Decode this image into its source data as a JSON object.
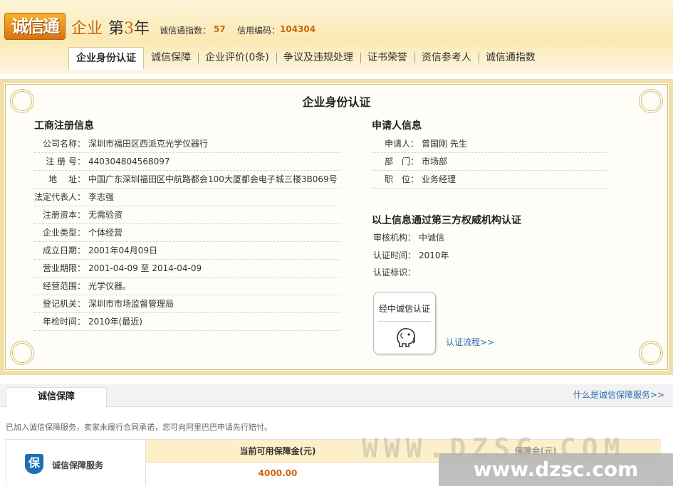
{
  "header": {
    "logo": "诚信通",
    "corp": "企业",
    "year_prefix": "第",
    "year_num": "3",
    "year_suffix": "年",
    "index_label": "诚信通指数：",
    "index_value": "57",
    "code_label": "信用编码：",
    "code_value": "104304"
  },
  "tabs": [
    {
      "label": "企业身份认证",
      "active": true
    },
    {
      "label": "诚信保障"
    },
    {
      "label": "企业评价(0条)"
    },
    {
      "label": "争议及违规处理"
    },
    {
      "label": "证书荣誉"
    },
    {
      "label": "资信参考人"
    },
    {
      "label": "诚信通指数"
    }
  ],
  "cert": {
    "title": "企业身份认证",
    "business_title": "工商注册信息",
    "business": [
      {
        "k": "公司名称：",
        "v": "深圳市福田区西派克光学仪器行"
      },
      {
        "k": "注 册 号：",
        "v": "440304804568097"
      },
      {
        "k": "地　 址：",
        "v": "中国广东深圳福田区中航路都会100大厦都会电子城三楼3B069号"
      },
      {
        "k": "法定代表人：",
        "v": "李志强"
      },
      {
        "k": "注册资本：",
        "v": "无需验资"
      },
      {
        "k": "企业类型：",
        "v": "个体经营"
      },
      {
        "k": "成立日期：",
        "v": "2001年04月09日"
      },
      {
        "k": "营业期限：",
        "v": "2001-04-09 至 2014-04-09"
      },
      {
        "k": "经营范围：",
        "v": "光学仪器。"
      },
      {
        "k": "登记机关：",
        "v": "深圳市市场监督管理局"
      },
      {
        "k": "年检时间：",
        "v": "2010年(最近)"
      }
    ],
    "applicant_title": "申请人信息",
    "applicant": [
      {
        "k": "申请人：",
        "v": "曾国刚 先生"
      },
      {
        "k": "部　门：",
        "v": "市场部"
      },
      {
        "k": "职　位：",
        "v": "业务经理"
      }
    ],
    "verify_title": "以上信息通过第三方权威机构认证",
    "verify": [
      {
        "k": "审核机构：",
        "v": "中诚信"
      },
      {
        "k": "认证时间：",
        "v": "2010年"
      },
      {
        "k": "认证标识：",
        "v": ""
      }
    ],
    "seal_text": "经中诚信认证",
    "flow_link": "认证流程>>"
  },
  "guarantee": {
    "tab": "诚信保障",
    "link": "什么是诚信保障服务>>",
    "note": "已加入诚信保障服务，卖家未履行合同承诺，您可向阿里巴巴申请先行赔付。",
    "service_icon": "保",
    "service_label": "诚信保障服务",
    "deposit_header": "当前可用保障金(元)",
    "deposit_value": "4000.00",
    "total_header": "保障金(元)"
  },
  "watermark": {
    "ghost": "WWW.DZSC.COM",
    "box": "www.dzsc.com"
  },
  "colors": {
    "accent": "#c8690d",
    "link": "#2a6bb0",
    "frame": "#f0dfa7",
    "brand_blue": "#1f6fb5"
  }
}
